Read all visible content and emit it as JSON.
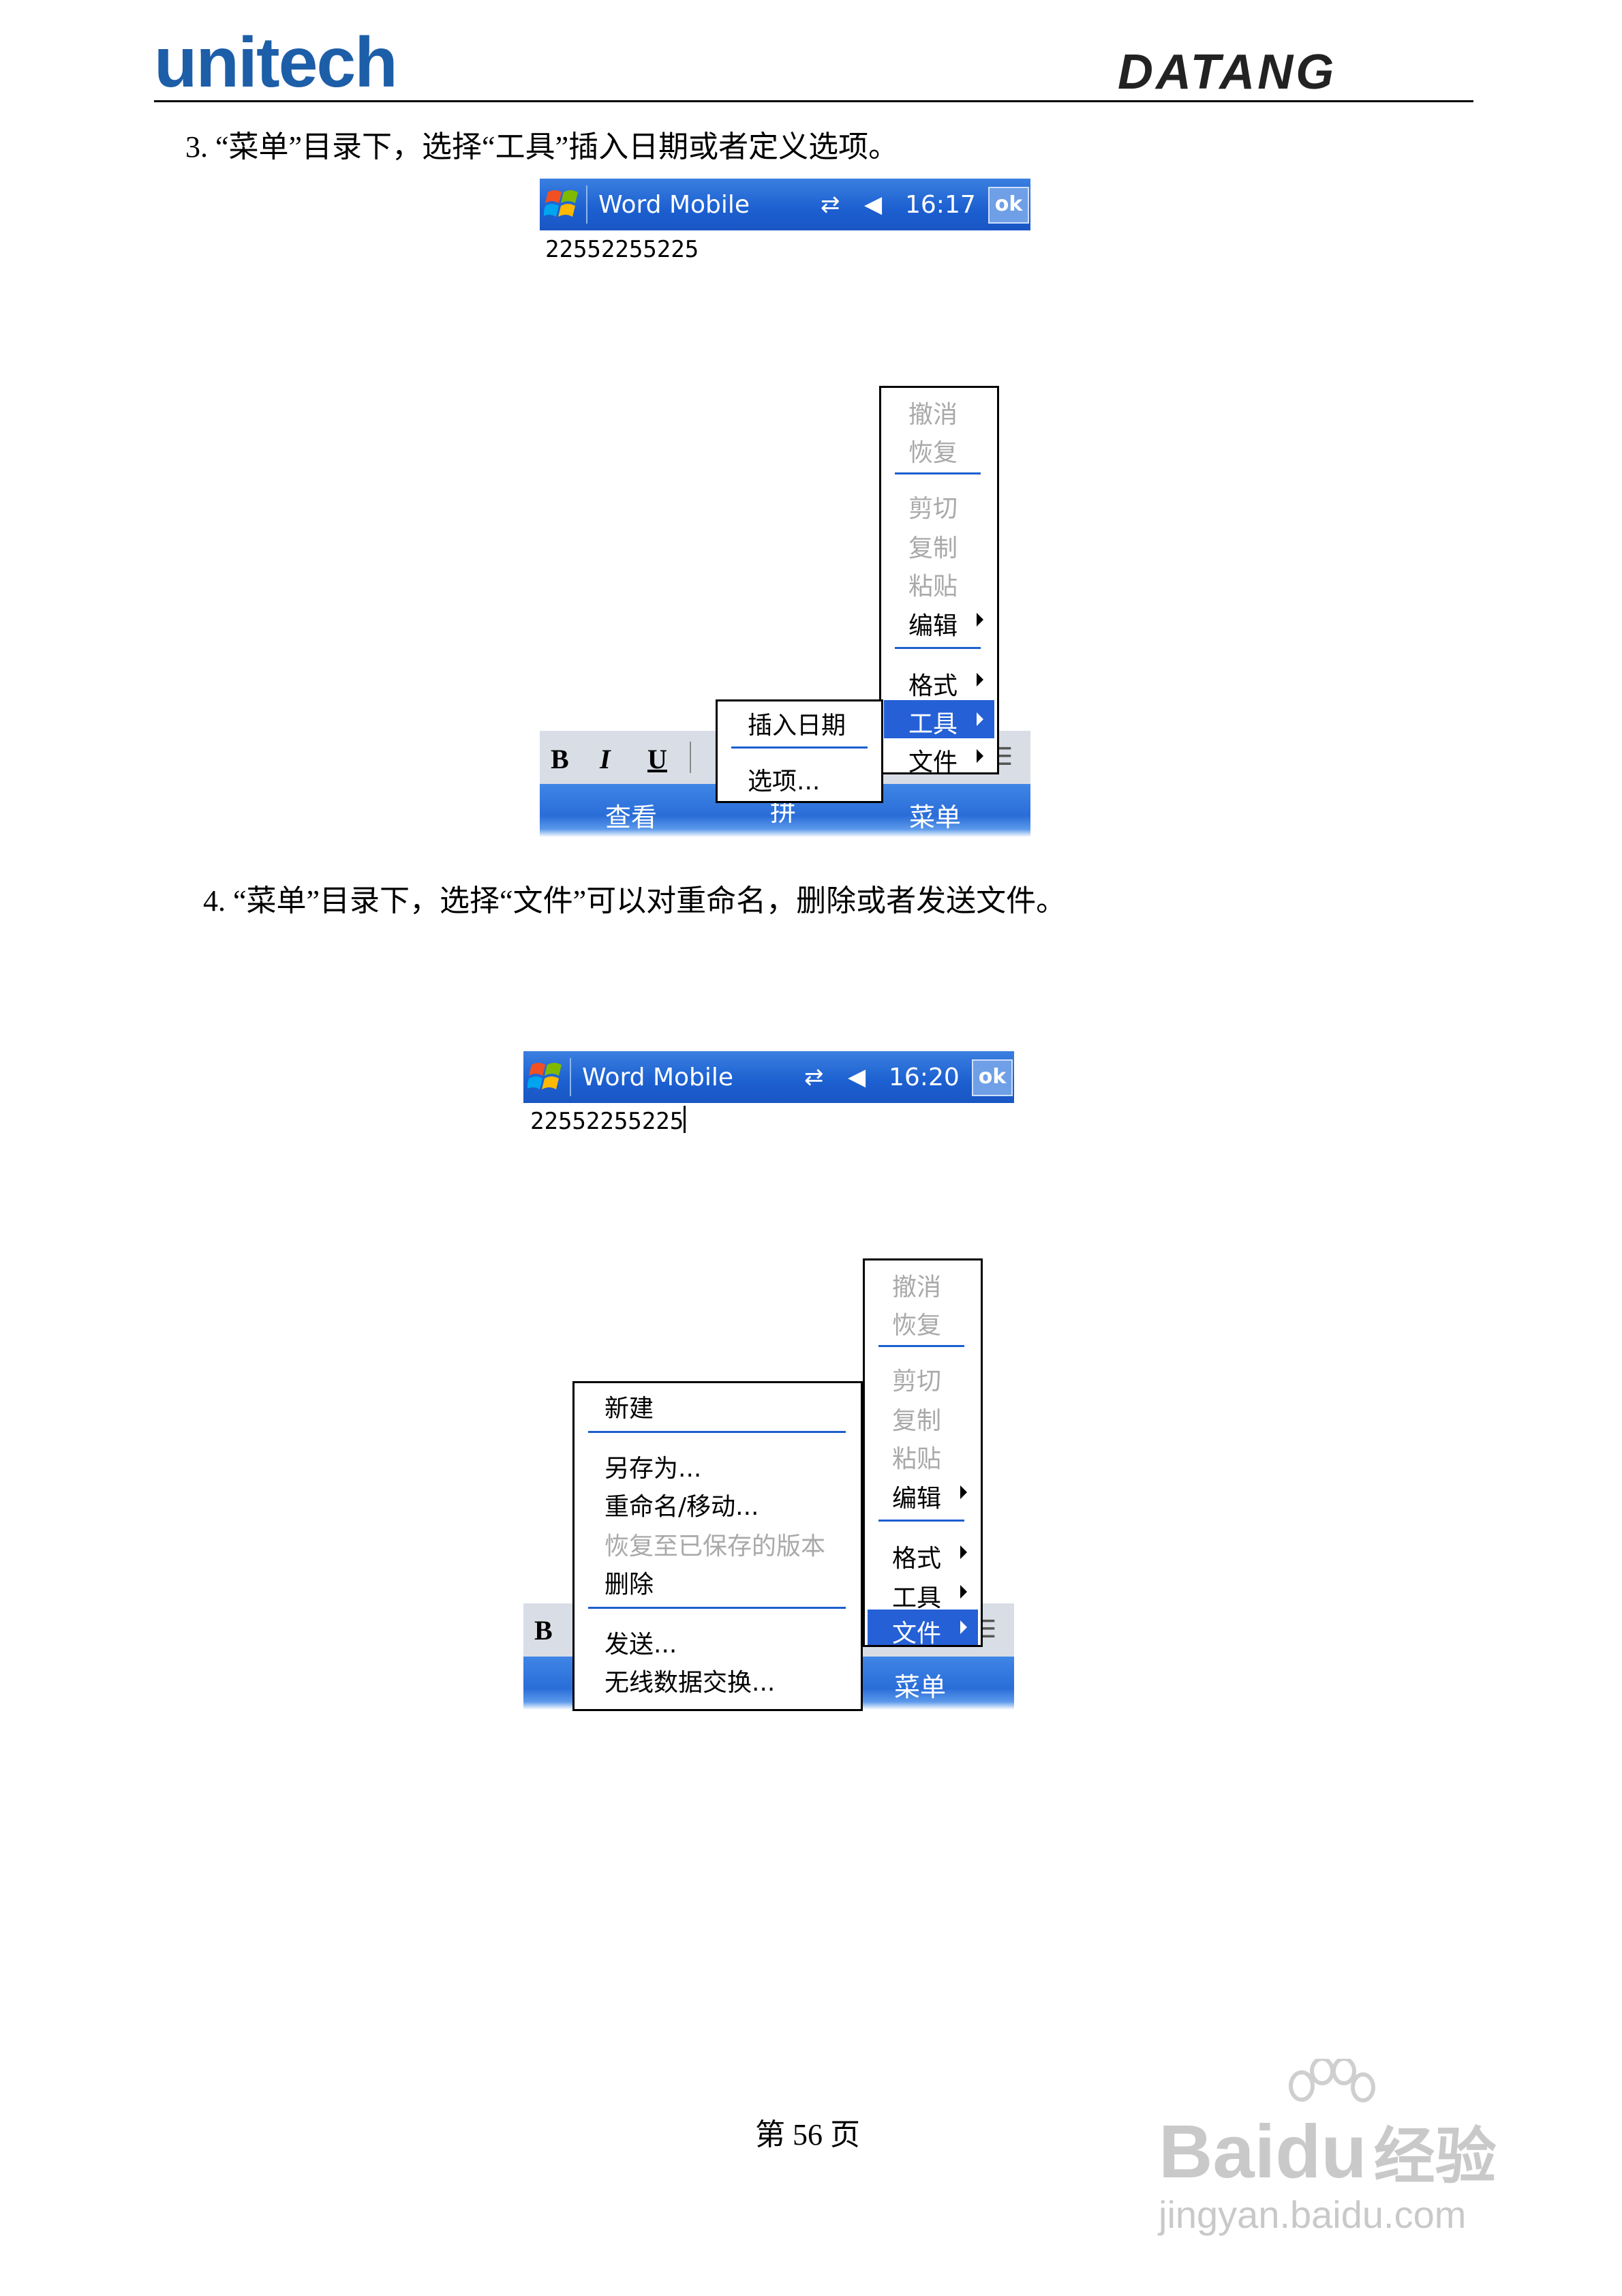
{
  "header": {
    "left_logo": "unitech",
    "right_logo": "DATANG"
  },
  "step3": {
    "text": "3.  “菜单”目录下，选择“工具”插入日期或者定义选项。",
    "screen": {
      "title": "Word Mobile",
      "time": "16:17",
      "ok": "ok",
      "doc_text": "22552255225",
      "main_menu": {
        "items": [
          "撤消",
          "恢复",
          "剪切",
          "复制",
          "粘贴",
          "编辑",
          "格式",
          "工具",
          "文件"
        ],
        "selected": "工具"
      },
      "submenu": {
        "items": [
          "插入日期",
          "选项..."
        ]
      },
      "toolbar": {
        "bold": "B",
        "italic": "I",
        "underline": "U"
      },
      "menubar": {
        "left": "查看",
        "middle": "拼",
        "right": "菜单"
      }
    }
  },
  "step4": {
    "text": "4.  “菜单”目录下，选择“文件”可以对重命名，删除或者发送文件。",
    "screen": {
      "title": "Word Mobile",
      "time": "16:20",
      "ok": "ok",
      "doc_text": "22552255225",
      "main_menu": {
        "items": [
          "撤消",
          "恢复",
          "剪切",
          "复制",
          "粘贴",
          "编辑",
          "格式",
          "工具",
          "文件"
        ],
        "selected": "文件"
      },
      "submenu": {
        "items": [
          "新建",
          "另存为...",
          "重命名/移动...",
          "恢复至已保存的版本",
          "删除",
          "发送...",
          "无线数据交换..."
        ],
        "disabled": "恢复至已保存的版本"
      },
      "toolbar": {
        "bold": "B"
      },
      "menubar": {
        "right": "菜单"
      }
    }
  },
  "footer": {
    "page": "第 56 页"
  },
  "watermark": {
    "brand_a": "Bai",
    "brand_b": "du",
    "brand_c": "经验",
    "url": "jingyan.baidu.com"
  },
  "colors": {
    "title_blue": "#1c5fd0",
    "selection": "#2560d6",
    "logo_blue": "#1d5ea8"
  }
}
